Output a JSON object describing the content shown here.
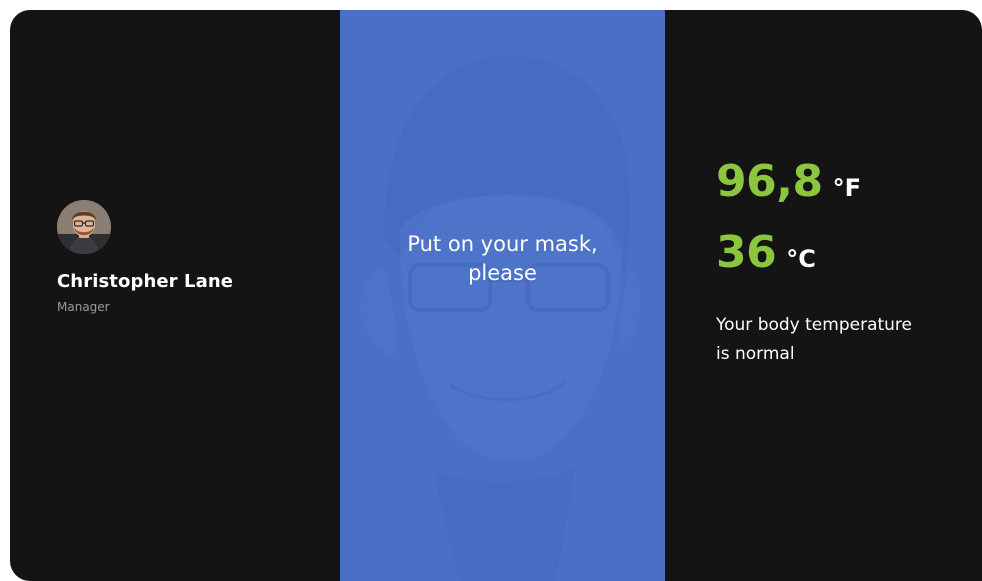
{
  "employee": {
    "name": "Christopher Lane",
    "role": "Manager"
  },
  "camera": {
    "prompt_line1": "Put on your mask,",
    "prompt_line2": "please"
  },
  "temperature": {
    "fahrenheit_value": "96,8",
    "fahrenheit_unit": "°F",
    "celsius_value": "36",
    "celsius_unit": "°C",
    "status_line1": "Your body temperature",
    "status_line2": "is normal"
  },
  "colors": {
    "background": "#141414",
    "camera_overlay": "#4a6fc6",
    "reading_accent": "#8cc63f",
    "text_primary": "#ffffff",
    "text_secondary": "#9a9a9a"
  },
  "icons": {
    "avatar": "user-photo"
  }
}
